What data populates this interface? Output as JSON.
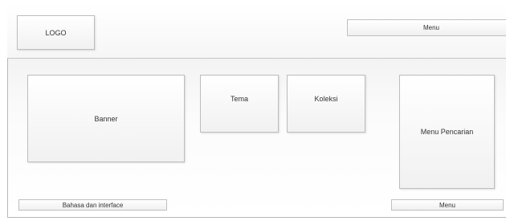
{
  "header": {
    "logo_label": "LOGO",
    "menu_label": "Menu"
  },
  "content": {
    "banner_label": "Banner",
    "tema_label": "Tema",
    "koleksi_label": "Koleksi",
    "search_menu_label": "Menu Pencarian"
  },
  "footer": {
    "language_label": "Bahasa dan interface",
    "menu_label": "Menu"
  },
  "colors": {
    "border": "#bdbdbd",
    "text": "#333333",
    "background": "#ffffff"
  }
}
